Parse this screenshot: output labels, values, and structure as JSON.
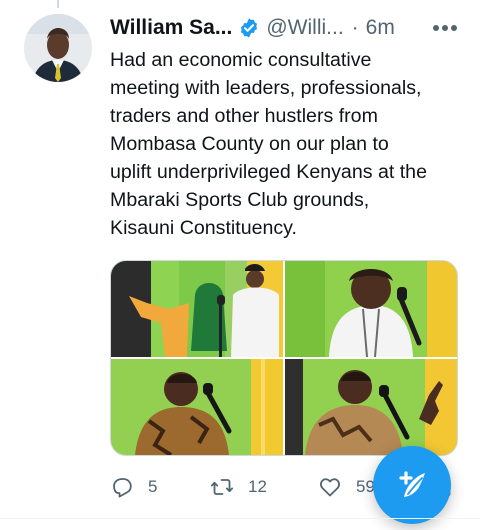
{
  "tweet": {
    "author_name": "William Sa...",
    "handle": "@Willi...",
    "separator": "·",
    "time": "6m",
    "text": "Had an economic consultative\nmeeting with leaders, professionals,\ntraders and other hustlers from\nMombasa County on our plan to\nuplift underprivileged Kenyans at the\nMbaraki Sports Club grounds,\nKisauni Constituency."
  },
  "media": {
    "count": 4
  },
  "actions": {
    "reply_count": "5",
    "retweet_count": "12",
    "like_count": "59"
  },
  "icons": {
    "verified": "verified-badge-icon",
    "more": "more-options-icon",
    "reply": "reply-icon",
    "retweet": "retweet-icon",
    "like": "heart-icon",
    "share": "share-icon",
    "compose": "compose-tweet-icon"
  },
  "colors": {
    "accent": "#1d9bf0",
    "text": "#0f1419",
    "secondary_text": "#536471",
    "border": "#cfd9de"
  }
}
